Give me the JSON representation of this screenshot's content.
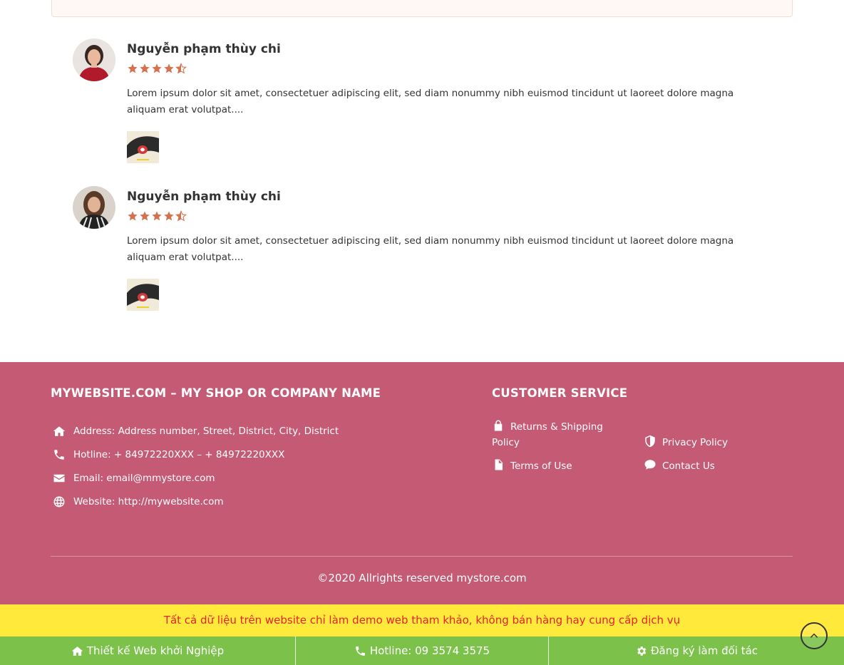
{
  "reviews": [
    {
      "name": "Nguyễn phạm thùy chi",
      "rating": 4.5,
      "text": "Lorem ipsum dolor sit amet, consectetuer adipiscing elit, sed diam nonummy nibh euismod tincidunt ut laoreet dolore magna aliquam erat volutpat...."
    },
    {
      "name": "Nguyễn phạm thùy chi",
      "rating": 4.5,
      "text": "Lorem ipsum dolor sit amet, consectetuer adipiscing elit, sed diam nonummy nibh euismod tincidunt ut laoreet dolore magna aliquam erat volutpat...."
    }
  ],
  "colors": {
    "star": "#d4714f",
    "footer_bg": "#c45a74",
    "notice_bg": "#ffe93b",
    "notice_text": "#e8212f",
    "bottom_bar_bg": "#7cc24a"
  },
  "footer": {
    "company_title": "MYWEBSITE.COM – MY SHOP OR COMPANY NAME",
    "contact": [
      {
        "icon": "home-icon",
        "text": "Address: Address number, Street, District, City, District"
      },
      {
        "icon": "phone-icon",
        "text": "Hotline: + 84972220XXX – + 84972220XXX"
      },
      {
        "icon": "envelope-icon",
        "text": "Email: email@mmystore.com"
      },
      {
        "icon": "globe-icon",
        "text": "Website: http://mywebsite.com"
      }
    ],
    "service_title": "CUSTOMER SERVICE",
    "service_links": [
      {
        "icon": "lock-icon",
        "label": "Returns & Shipping Policy"
      },
      {
        "icon": "shield-icon",
        "label": "Privacy Policy"
      },
      {
        "icon": "file-icon",
        "label": "Terms of Use"
      },
      {
        "icon": "comment-icon",
        "label": "Contact Us"
      }
    ],
    "copyright": "©2020 Allrights reserved mystore.com"
  },
  "notice": "Tất cả dữ liệu trên website chỉ làm demo web tham khảo, không bán hàng hay cung cấp dịch vụ",
  "bottom_bar": [
    {
      "icon": "home-icon",
      "label": "Thiết kế Web khởi Nghiệp"
    },
    {
      "icon": "phone-icon",
      "label": "Hotline: 09 3574 3575"
    },
    {
      "icon": "gear-icon",
      "label": "Đăng ký làm đối tác"
    }
  ]
}
